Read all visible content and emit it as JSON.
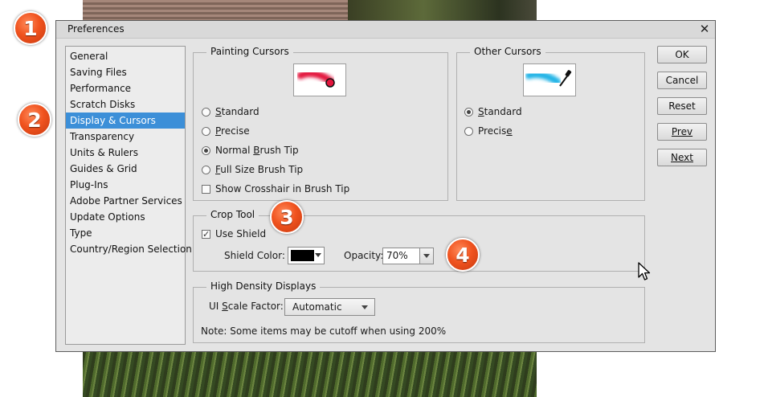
{
  "window": {
    "title": "Preferences"
  },
  "sidebar": {
    "items": [
      {
        "label": "General"
      },
      {
        "label": "Saving Files"
      },
      {
        "label": "Performance"
      },
      {
        "label": "Scratch Disks"
      },
      {
        "label": "Display & Cursors",
        "active": true
      },
      {
        "label": "Transparency"
      },
      {
        "label": "Units & Rulers"
      },
      {
        "label": "Guides & Grid"
      },
      {
        "label": "Plug-Ins"
      },
      {
        "label": "Adobe Partner Services"
      },
      {
        "label": "Update Options"
      },
      {
        "label": "Type"
      },
      {
        "label": "Country/Region Selection"
      }
    ]
  },
  "painting_cursors": {
    "title": "Painting Cursors",
    "options": {
      "standard": {
        "prefix": "",
        "key": "S",
        "rest": "tandard",
        "selected": false
      },
      "precise": {
        "prefix": "",
        "key": "P",
        "rest": "recise",
        "selected": false
      },
      "normal": {
        "prefix": "Normal ",
        "key": "B",
        "rest": "rush Tip",
        "selected": true
      },
      "fullsize": {
        "prefix": "",
        "key": "F",
        "rest": "ull Size Brush Tip",
        "selected": false
      }
    },
    "crosshair": {
      "label": "Show Crosshair in Brush Tip",
      "checked": false
    }
  },
  "other_cursors": {
    "title": "Other Cursors",
    "standard": {
      "prefix": "",
      "key": "S",
      "rest": "tandard",
      "selected": true
    },
    "precise": {
      "prefix": "Precis",
      "key": "e",
      "rest": "",
      "selected": false
    }
  },
  "crop_tool": {
    "title": "Crop Tool",
    "use_shield": {
      "label": "Use Shield",
      "checked": true
    },
    "shield_color_label": "Shield Color:",
    "shield_color": "#000000",
    "opacity_label": "Opacity:",
    "opacity_value": "70%"
  },
  "high_density": {
    "title": "High Density Displays",
    "scale_label": {
      "prefix": "UI ",
      "key": "S",
      "rest": "cale Factor:"
    },
    "scale_value": "Automatic",
    "note": "Note: Some items may be cutoff when using 200%"
  },
  "buttons": {
    "ok": "OK",
    "cancel": "Cancel",
    "reset": "Reset",
    "prev": "Prev",
    "next": "Next"
  },
  "annotations": [
    "1",
    "2",
    "3",
    "4"
  ],
  "colors": {
    "accent_selection": "#3c8fd8",
    "badge_orange": "#f0531f",
    "painting_cursor_stroke": "#e3143c",
    "other_cursor_stroke": "#22b4e6"
  },
  "icons": {
    "painting_preview": "brush-stroke-circle-icon",
    "other_preview": "eyedropper-icon",
    "close": "close-icon",
    "mouse": "arrow-cursor-icon"
  }
}
